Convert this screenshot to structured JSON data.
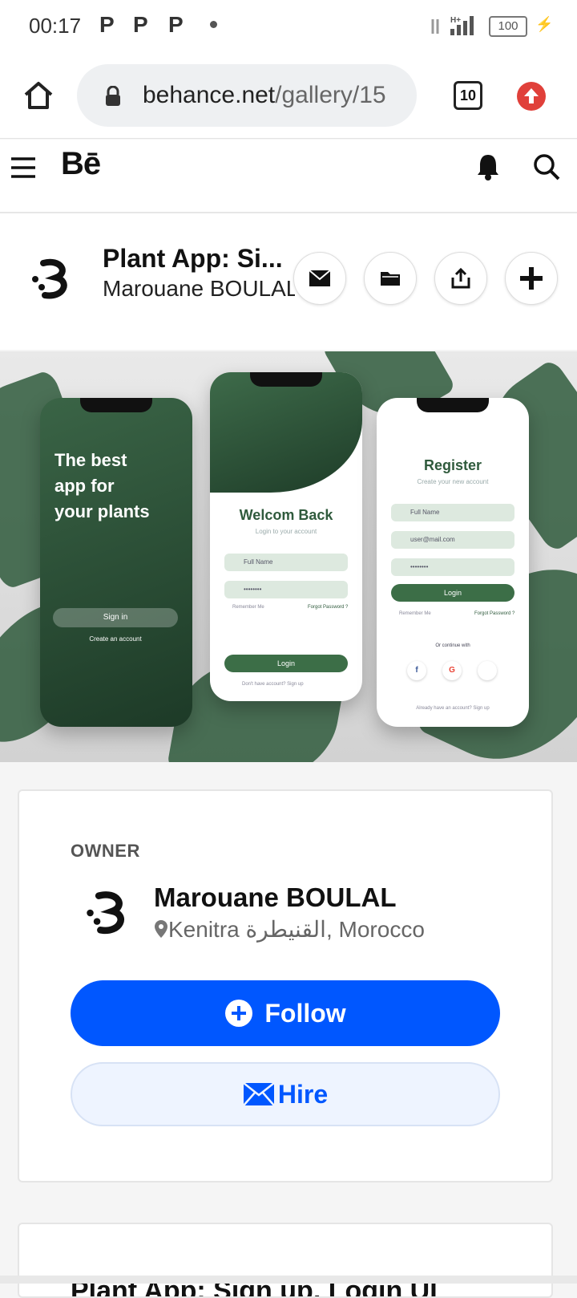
{
  "status_bar": {
    "time": "00:17",
    "notifications": [
      "P",
      "P",
      "P"
    ],
    "battery": "100"
  },
  "browser": {
    "url_domain": "behance.net",
    "url_path": "/gallery/15",
    "tab_count": "10"
  },
  "behance_nav": {
    "logo": "Bē"
  },
  "project": {
    "title": "Plant App: Si...",
    "owner": "Marouane BOULAL"
  },
  "hero": {
    "phone1": {
      "headline_l1": "The best",
      "headline_l2": "app for",
      "headline_l3": "your plants",
      "signin": "Sign in",
      "create": "Create an account"
    },
    "phone2": {
      "title": "Welcom Back",
      "subtitle": "Login to your account",
      "name_field": "Full Name",
      "password_field": "••••••••",
      "remember": "Remember Me",
      "forgot": "Forgot Password ?",
      "login": "Login",
      "signup": "Don't have account?  Sign up"
    },
    "phone3": {
      "title": "Register",
      "subtitle": "Create your new account",
      "name_field": "Full Name",
      "email_field": "user@mail.com",
      "password_field": "••••••••",
      "login": "Login",
      "remember": "Remember Me",
      "forgot": "Forgot Password ?",
      "continue": "Or continue with",
      "already": "Already have an account?  Sign up"
    }
  },
  "owner_card": {
    "label": "OWNER",
    "name": "Marouane BOULAL",
    "location": "Kenitra القنيطرة, Morocco",
    "follow": "Follow",
    "hire": "Hire"
  },
  "next_card": {
    "title": "Plant App: Sign up, Login UI"
  },
  "colors": {
    "accent": "#0057ff",
    "plant_green": "#2f5a3c",
    "browser_update": "#e0403a"
  }
}
